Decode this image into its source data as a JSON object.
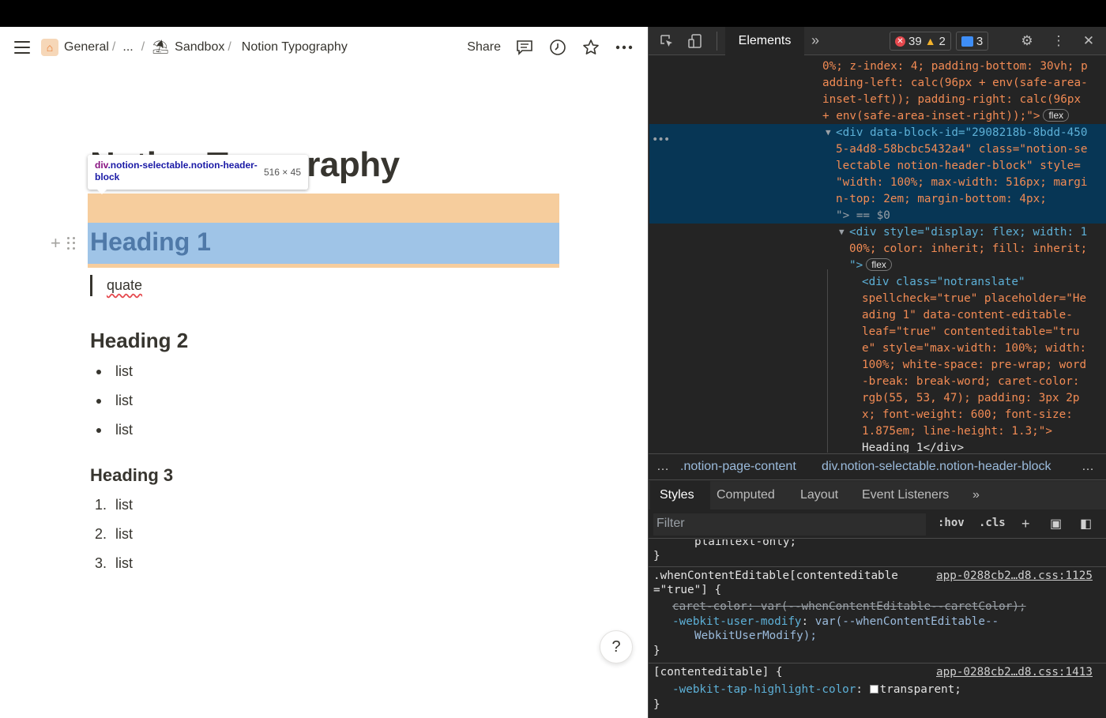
{
  "notion": {
    "breadcrumbs": {
      "general": "General",
      "sep1": "/",
      "ellipsis": "...",
      "sep2": "/",
      "sandbox": "Sandbox",
      "sep3": "/",
      "page": "Notion Typography"
    },
    "toolbar": {
      "share": "Share"
    },
    "page": {
      "title": "Notion Typography",
      "heading1": "Heading 1",
      "quote": "quate",
      "heading2": "Heading 2",
      "bullets": [
        "list",
        "list",
        "list"
      ],
      "heading3": "Heading 3",
      "numbered": [
        {
          "n": "1.",
          "text": "list"
        },
        {
          "n": "2.",
          "text": "list"
        },
        {
          "n": "3.",
          "text": "list"
        }
      ]
    },
    "tooltip": {
      "tag": "div",
      "classes": ".notion-selectable.notion-header-block",
      "size": "516 × 45"
    },
    "help": "?"
  },
  "devtools": {
    "tab": "Elements",
    "counters": {
      "errors": "39",
      "warnings": "2",
      "messages": "3"
    },
    "dom_lines": [
      "0%; z-index: 4; padding-bottom: 30vh; p",
      "adding-left: calc(96px + env(safe-area-",
      "inset-left)); padding-right: calc(96px",
      "+ env(safe-area-inset-right));\">",
      "<div data-block-id=\"2908218b-8bdd-450",
      "5-a4d8-58bcbc5432a4\" class=\"notion-se",
      "lectable notion-header-block\" style=",
      "\"width: 100%; max-width: 516px; margi",
      "n-top: 2em; margin-bottom: 4px;",
      "\"> == $0",
      "<div style=\"display: flex; width: 1",
      "00%; color: inherit; fill: inherit;",
      "\">",
      "<div class=\"notranslate\"",
      "spellcheck=\"true\" placeholder=\"He",
      "ading 1\" data-content-editable-",
      "leaf=\"true\" contenteditable=\"tru",
      "e\" style=\"max-width: 100%; width:",
      "100%; white-space: pre-wrap; word",
      "-break: break-word; caret-color:",
      "rgb(55, 53, 47); padding: 3px 2p",
      "x; font-weight: 600; font-size:",
      "1.875em; line-height: 1.3;\">",
      "Heading 1</div>"
    ],
    "flex_badge": "flex",
    "breadcrumb": {
      "more_left": "…",
      "item1": "​.notion-page-content",
      "item2": "div.notion-selectable.notion-header-block",
      "more_right": "…"
    },
    "style_tabs": [
      "Styles",
      "Computed",
      "Layout",
      "Event Listeners"
    ],
    "filter_placeholder": "Filter",
    "hov": ":hov",
    "cls": ".cls",
    "styles": {
      "clipped": "plaintext-only;",
      "rule1_selector_a": ".whenContentEditable[contenteditable",
      "rule1_selector_b": "=\"true\"] {",
      "rule1_link": "app-0288cb2…d8.css:1125",
      "rule1_p1_name": "caret-color",
      "rule1_p1_value": "var(--whenContentEditable--caretColor);",
      "rule1_p2_name": "-webkit-user-modify",
      "rule1_p2_value_a": "var(--whenContentEditable--",
      "rule1_p2_value_b": "WebkitUserModify);",
      "rule2_selector": "[contenteditable] {",
      "rule2_link": "app-0288cb2…d8.css:1413",
      "rule2_p1_name": "-webkit-tap-highlight-color",
      "rule2_p1_value": "transparent;"
    }
  }
}
